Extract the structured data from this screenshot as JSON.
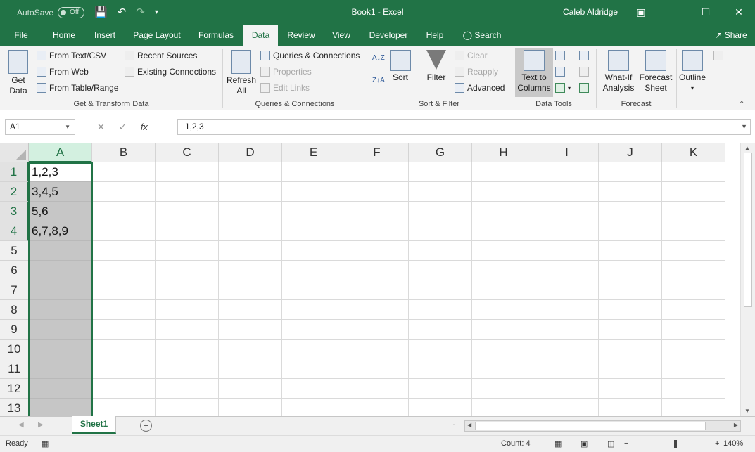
{
  "titlebar": {
    "autosave_label": "AutoSave",
    "autosave_state": "Off",
    "doc_title": "Book1  -  Excel",
    "user": "Caleb Aldridge",
    "quick_access_icons": [
      "save-icon",
      "undo-icon",
      "redo-icon",
      "customize-icon"
    ]
  },
  "tabs": [
    "File",
    "Home",
    "Insert",
    "Page Layout",
    "Formulas",
    "Data",
    "Review",
    "View",
    "Developer",
    "Help",
    "Search"
  ],
  "share_label": "Share",
  "ribbon": {
    "get_transform": {
      "get_data": "Get\nData",
      "from_text_csv": "From Text/CSV",
      "from_web": "From Web",
      "from_table": "From Table/Range",
      "recent_sources": "Recent Sources",
      "existing_connections": "Existing Connections",
      "label": "Get & Transform Data"
    },
    "queries": {
      "refresh_all": "Refresh\nAll",
      "queries_connections": "Queries & Connections",
      "properties": "Properties",
      "edit_links": "Edit Links",
      "label": "Queries & Connections"
    },
    "sort_filter": {
      "sort": "Sort",
      "filter": "Filter",
      "clear": "Clear",
      "reapply": "Reapply",
      "advanced": "Advanced",
      "label": "Sort & Filter"
    },
    "data_tools": {
      "text_to_columns": "Text to\nColumns",
      "label": "Data Tools"
    },
    "forecast": {
      "what_if": "What-If\nAnalysis",
      "forecast_sheet": "Forecast\nSheet",
      "label": "Forecast"
    },
    "outline": {
      "outline": "Outline"
    }
  },
  "formula_bar": {
    "name_box": "A1",
    "formula": "1,2,3",
    "fx": "fx"
  },
  "grid": {
    "columns": [
      "A",
      "B",
      "C",
      "D",
      "E",
      "F",
      "G",
      "H",
      "I",
      "J",
      "K"
    ],
    "rows": [
      "1",
      "2",
      "3",
      "4",
      "5",
      "6",
      "7",
      "8",
      "9",
      "10",
      "11",
      "12",
      "13"
    ],
    "colA_values": [
      "1,2,3",
      "3,4,5",
      "5,6",
      "6,7,8,9",
      "",
      "",
      "",
      "",
      "",
      "",
      "",
      "",
      ""
    ]
  },
  "sheets": [
    "Sheet1"
  ],
  "statusbar": {
    "ready": "Ready",
    "count": "Count: 4",
    "zoom": "140%"
  }
}
